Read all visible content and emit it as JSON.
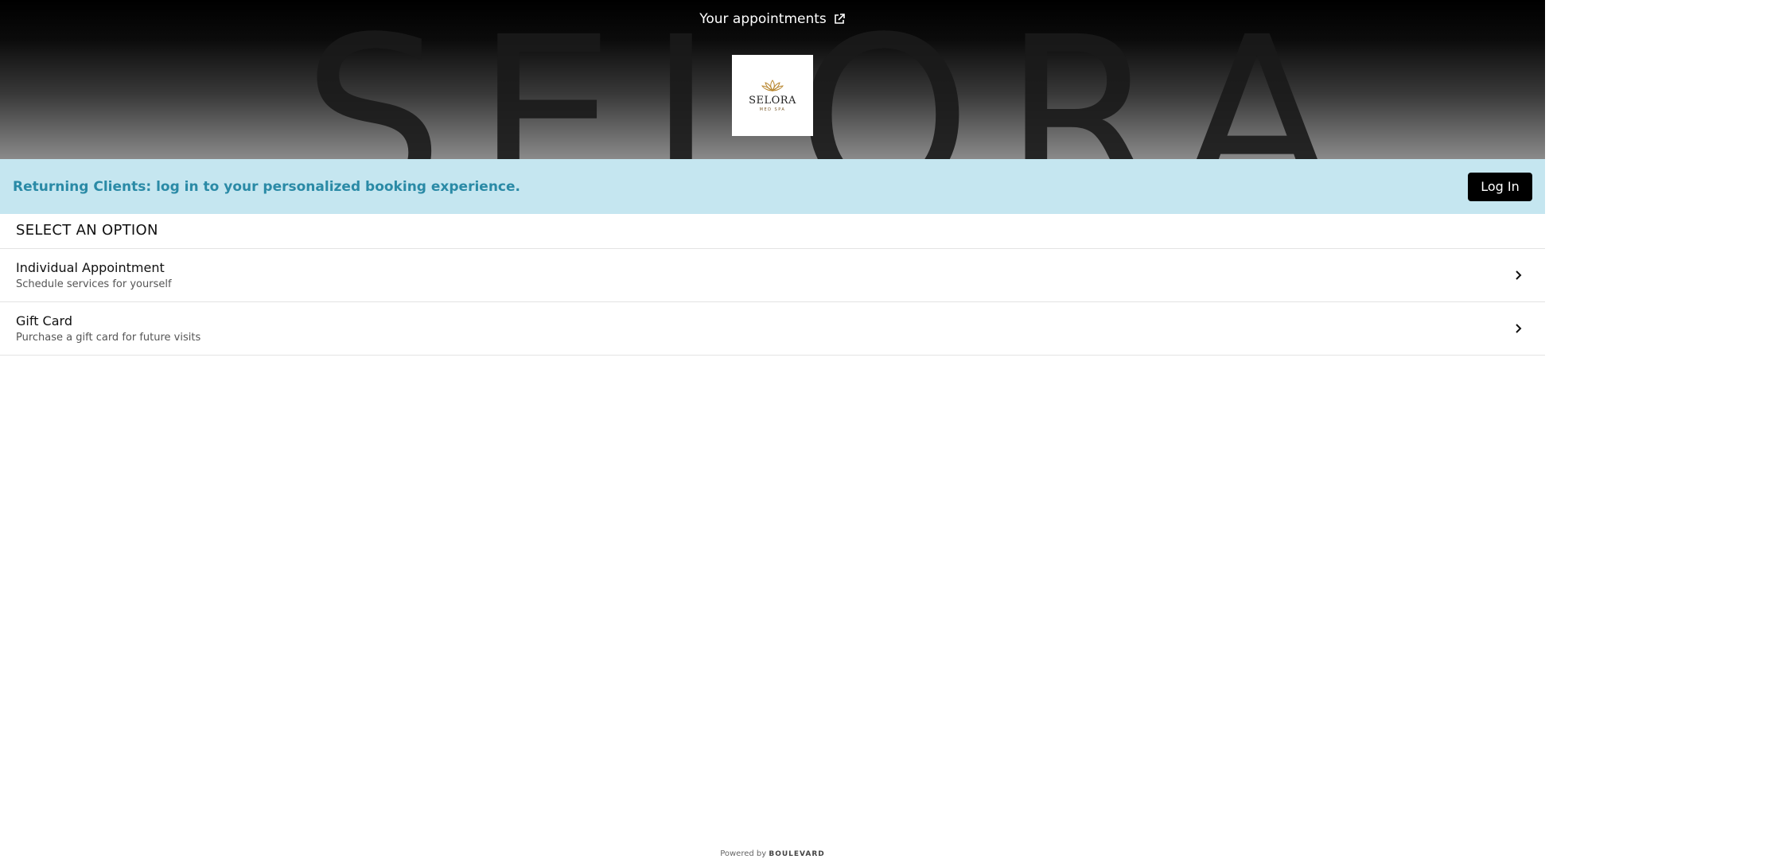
{
  "header": {
    "appointments_link": "Your appointments",
    "brand_watermark": "SELORA",
    "logo": {
      "name": "SELORA",
      "sub": "MED SPA"
    }
  },
  "banner": {
    "text": "Returning Clients: log in to your personalized booking experience.",
    "login_label": "Log In",
    "background": "#c5e6f0",
    "text_color": "#2a8aa6"
  },
  "section": {
    "title": "SELECT AN OPTION"
  },
  "options": [
    {
      "title": "Individual Appointment",
      "subtitle": "Schedule services for yourself"
    },
    {
      "title": "Gift Card",
      "subtitle": "Purchase a gift card for future visits"
    }
  ],
  "footer": {
    "powered_by": "Powered by",
    "brand": "BOULEVARD"
  }
}
